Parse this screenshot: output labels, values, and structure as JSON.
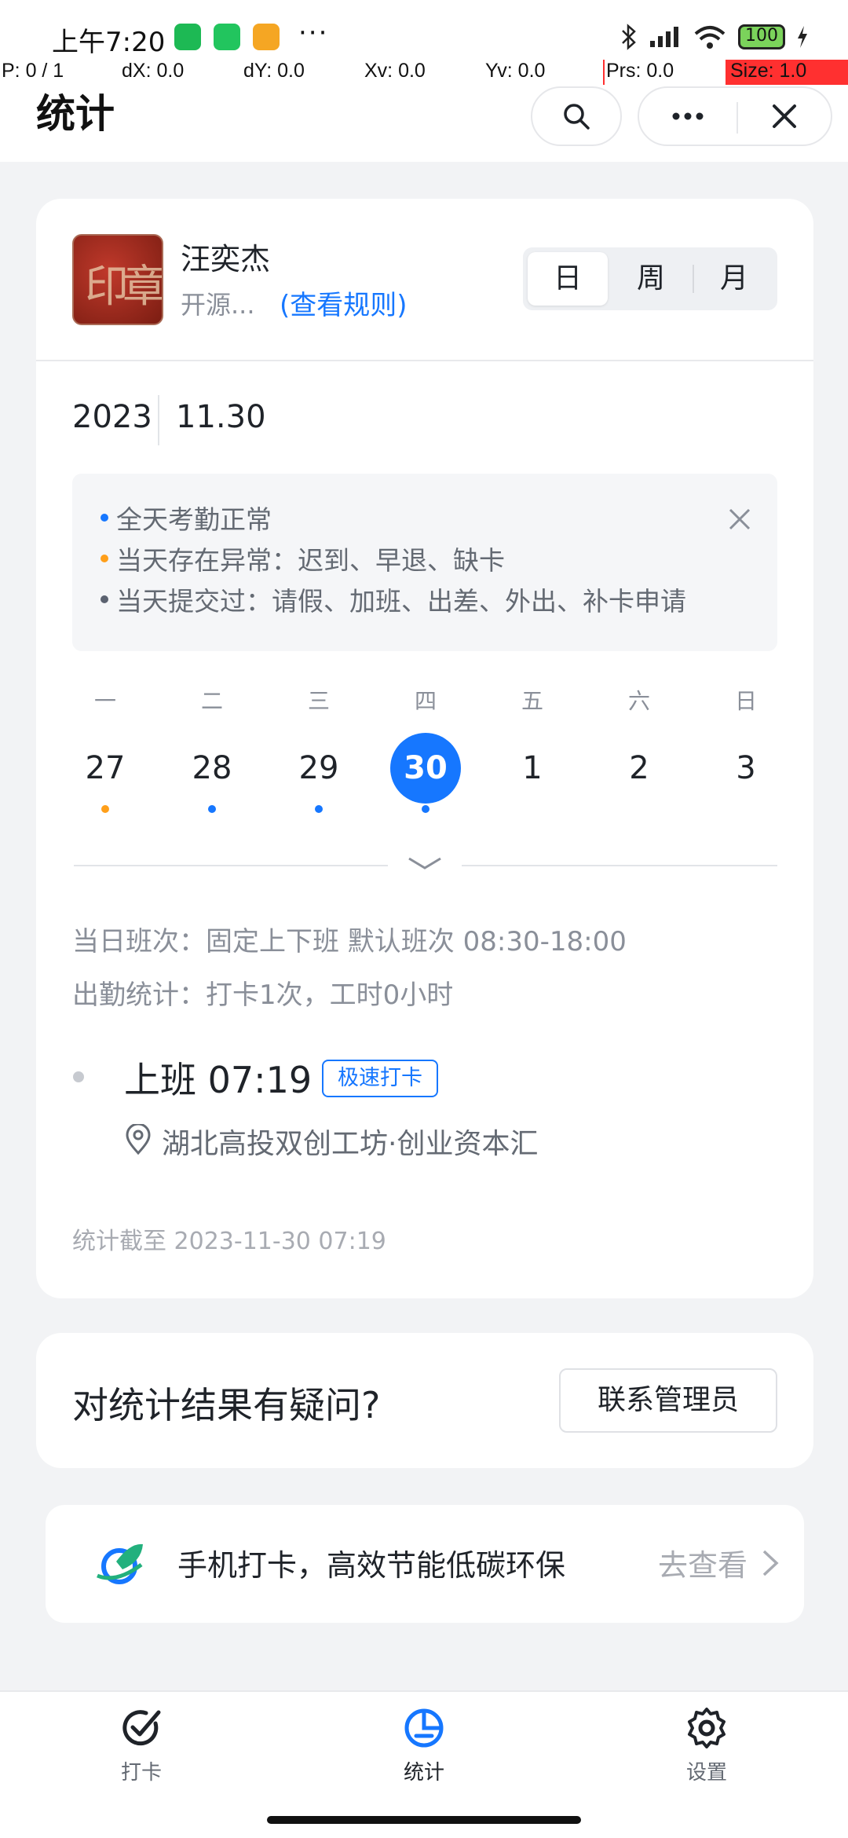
{
  "status_bar": {
    "time": "上午7:20",
    "more": "···",
    "battery": "100",
    "colors": {
      "app1": "#1db954",
      "app2": "#22c55e",
      "app3": "#f5a623"
    }
  },
  "debug": {
    "p": "P: 0 / 1",
    "dx": "dX: 0.0",
    "dy": "dY: 0.0",
    "xv": "Xv: 0.0",
    "yv": "Yv: 0.0",
    "prs": "Prs: 0.0",
    "size": "Size: 1.0"
  },
  "header": {
    "title": "统计"
  },
  "user": {
    "name": "汪奕杰",
    "org": "开源...",
    "rule_link": "(查看规则)"
  },
  "segmented": {
    "day": "日",
    "week": "周",
    "month": "月",
    "selected": "日"
  },
  "date": {
    "year": "2023",
    "month_day": "11.30"
  },
  "legend": {
    "items": [
      {
        "text": "全天考勤正常",
        "color": "#1677ff"
      },
      {
        "text": "当天存在异常：迟到、早退、缺卡",
        "color": "#ff9f1a"
      },
      {
        "text": "当天提交过：请假、加班、出差、外出、补卡申请",
        "color": "#5b6270"
      }
    ]
  },
  "week": {
    "headers": [
      "一",
      "二",
      "三",
      "四",
      "五",
      "六",
      "日"
    ],
    "days": [
      "27",
      "28",
      "29",
      "30",
      "1",
      "2",
      "3"
    ],
    "selected_index": 3,
    "dots": [
      "#ff9f1a",
      "#1677ff",
      "#1677ff",
      "#1677ff",
      "",
      "",
      ""
    ]
  },
  "shift_info": {
    "shift": "当日班次：固定上下班 默认班次 08:30-18:00",
    "stats": "出勤统计：打卡1次，工时0小时"
  },
  "punch": {
    "title": "上班 07:19",
    "tag": "极速打卡",
    "location": "湖北高投双创工坊·创业资本汇"
  },
  "footer": {
    "stat_time": "统计截至 2023-11-30 07:19"
  },
  "question": {
    "text": "对统计结果有疑问?",
    "button": "联系管理员"
  },
  "promo": {
    "text": "手机打卡，高效节能低碳环保",
    "link": "去查看"
  },
  "tabs": [
    {
      "label": "打卡",
      "icon": "check-icon"
    },
    {
      "label": "统计",
      "icon": "chart-icon",
      "active": true
    },
    {
      "label": "设置",
      "icon": "gear-icon"
    }
  ],
  "accent_color": "#1677ff"
}
